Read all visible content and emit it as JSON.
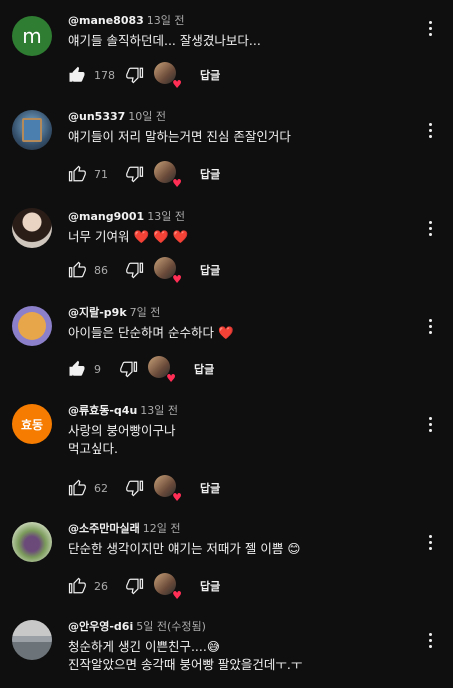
{
  "reply_label": "답글",
  "colors": {
    "background": "#0f0f0f",
    "text": "#f1f1f1",
    "muted": "#aaaaaa",
    "heart": "#e0245e"
  },
  "comments": [
    {
      "author": "@mane8083",
      "time": "13일 전",
      "lines": [
        "얘기들 솔직하던데... 잘생겼나보다..."
      ],
      "likes": "178",
      "liked": true,
      "avatar": "letter-m"
    },
    {
      "author": "@un5337",
      "time": "10일 전",
      "lines": [
        "얘기들이 저리 말하는거면 진심 존잘인거다"
      ],
      "likes": "71",
      "liked": false,
      "avatar": "photo"
    },
    {
      "author": "@mang9001",
      "time": "13일 전",
      "lines": [
        "너무 기여워"
      ],
      "hearts": "❤️ ❤️ ❤️",
      "likes": "86",
      "liked": false,
      "avatar": "photo"
    },
    {
      "author": "@지랄-p9k",
      "time": "7일 전",
      "lines": [
        "아이들은 단순하며 순수하다"
      ],
      "hearts": "❤️",
      "likes": "9",
      "liked": true,
      "avatar": "cartoon"
    },
    {
      "author": "@류효동-q4u",
      "time": "13일 전",
      "lines": [
        "사랑의 붕어빵이구나",
        "먹고싶다."
      ],
      "likes": "62",
      "liked": false,
      "avatar": "text-badge",
      "avatar_text": "효동"
    },
    {
      "author": "@소주만마실래",
      "time": "12일 전",
      "lines": [
        "단순한 생각이지만 얘기는 저때가 젤 이쁨"
      ],
      "emoji": "😊",
      "likes": "26",
      "liked": false,
      "avatar": "photo"
    },
    {
      "author": "@안우영-d6i",
      "time": "5일 전(수정됨)",
      "lines": [
        "청순하게 생긴 이쁜친구....",
        "진작알았으면 송각때 붕어빵 팔았을건데ㅜ.ㅜ"
      ],
      "emoji": "😅",
      "likes": "",
      "liked": false,
      "avatar": "photo"
    }
  ]
}
